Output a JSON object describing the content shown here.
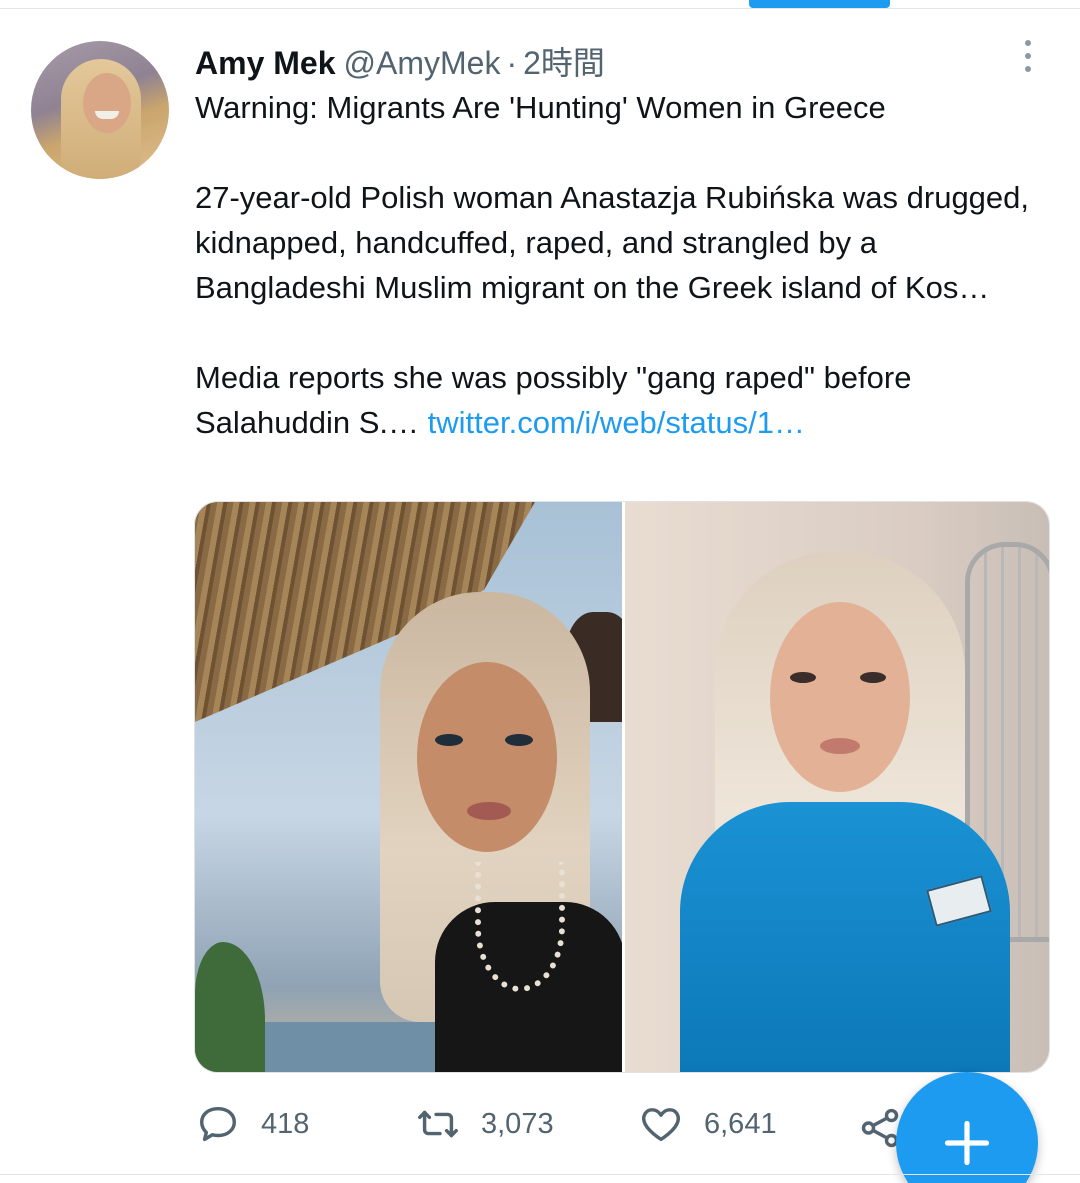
{
  "tweet": {
    "display_name": "Amy Mek",
    "handle": "@AmyMek",
    "separator": "·",
    "time": "2時間",
    "paragraph_1": "Warning: Migrants Are 'Hunting' Women in Greece",
    "paragraph_2": "27-year-old Polish woman Anastazja Rubińska was drugged, kidnapped, handcuffed, raped, and strangled by a Bangladeshi Muslim migrant on the Greek island of Kos…",
    "paragraph_3": "Media reports she was possibly \"gang raped\" before Salahuddin S.…",
    "link": "twitter.com/i/web/status/1…"
  },
  "actions": {
    "reply_count": "418",
    "retweet_count": "3,073",
    "like_count": "6,641"
  },
  "icons": {
    "more": "more-vertical-icon",
    "reply": "reply-icon",
    "retweet": "retweet-icon",
    "like": "heart-icon",
    "share": "share-icon",
    "compose": "plus-icon"
  },
  "colors": {
    "accent": "#1d9bf0",
    "text_primary": "#0f1419",
    "text_secondary": "#536471"
  }
}
